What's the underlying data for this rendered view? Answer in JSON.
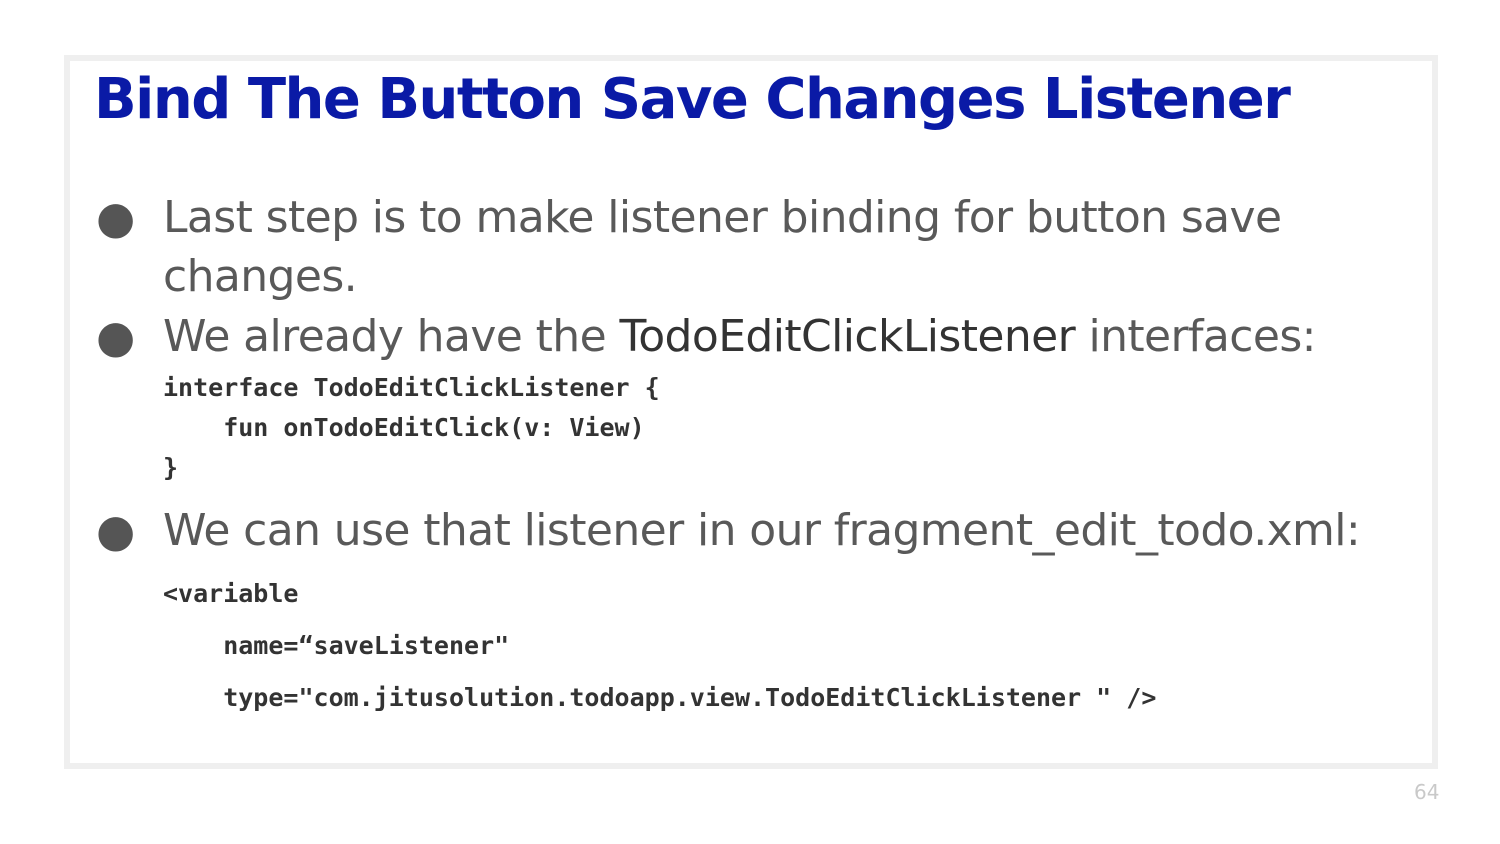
{
  "slide": {
    "title": "Bind The Button Save Changes Listener",
    "bullet_symbol": "●",
    "bullets": [
      {
        "line1": "Last step is to make listener binding for button save",
        "line2": "changes."
      },
      {
        "before": "We already have the ",
        "highlight": "TodoEditClickListener",
        "after": " interfaces:"
      },
      {
        "text": "We can use that listener in our fragment_edit_todo.xml:"
      }
    ],
    "code_interface": [
      "interface TodoEditClickListener {",
      "    fun onTodoEditClick(v: View)",
      "}"
    ],
    "code_variable": [
      "<variable",
      "    name=“saveListener\"",
      "    type=\"com.jitusolution.todoapp.view.TodoEditClickListener \" />"
    ],
    "page_number": "64"
  }
}
